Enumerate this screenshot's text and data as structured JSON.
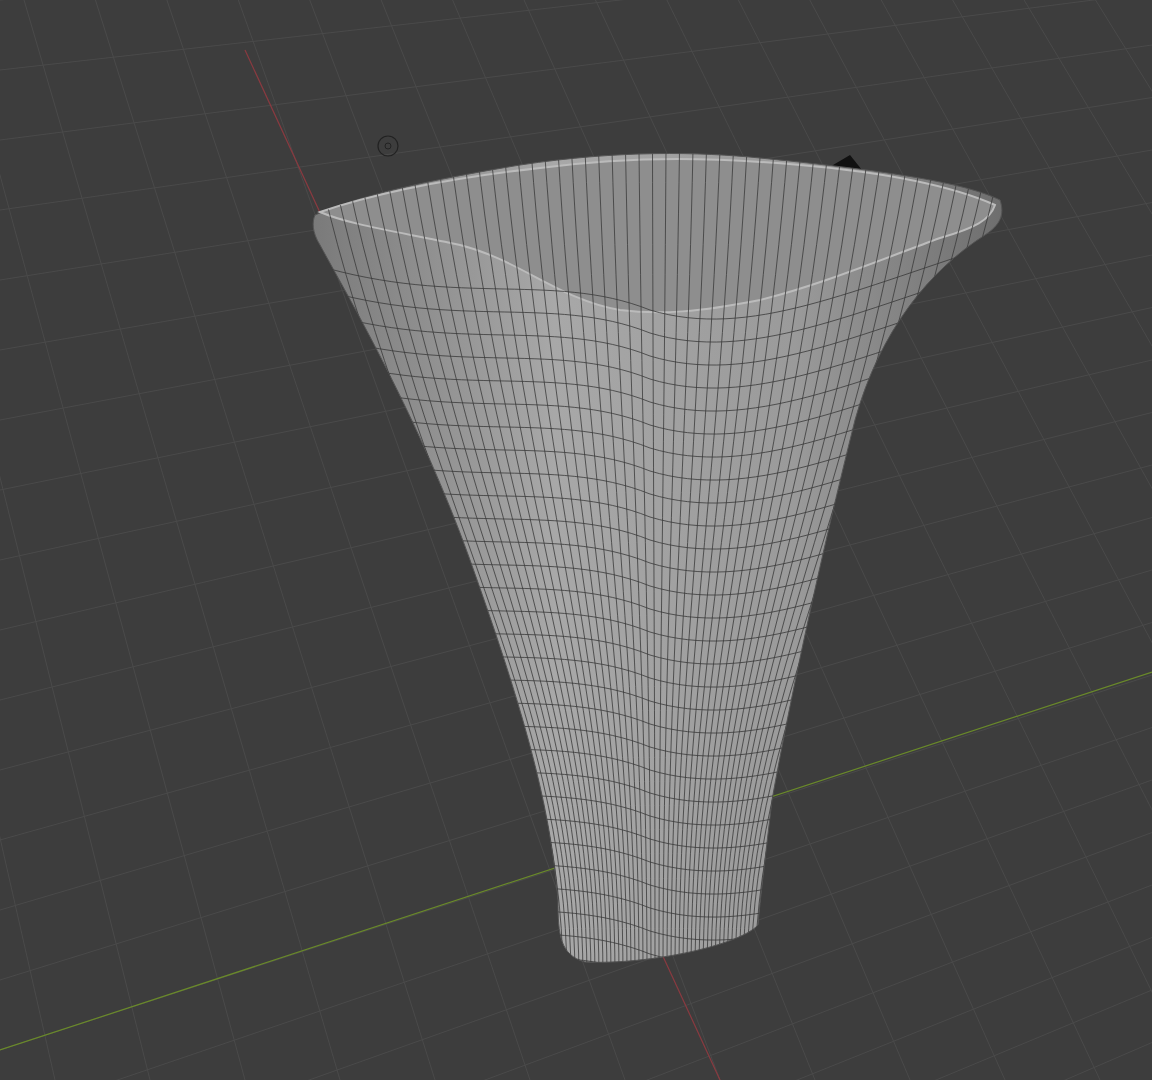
{
  "viewport": {
    "show_floor_grid": true,
    "show_axis_x": true,
    "show_axis_y": true,
    "show_wireframe": true
  }
}
